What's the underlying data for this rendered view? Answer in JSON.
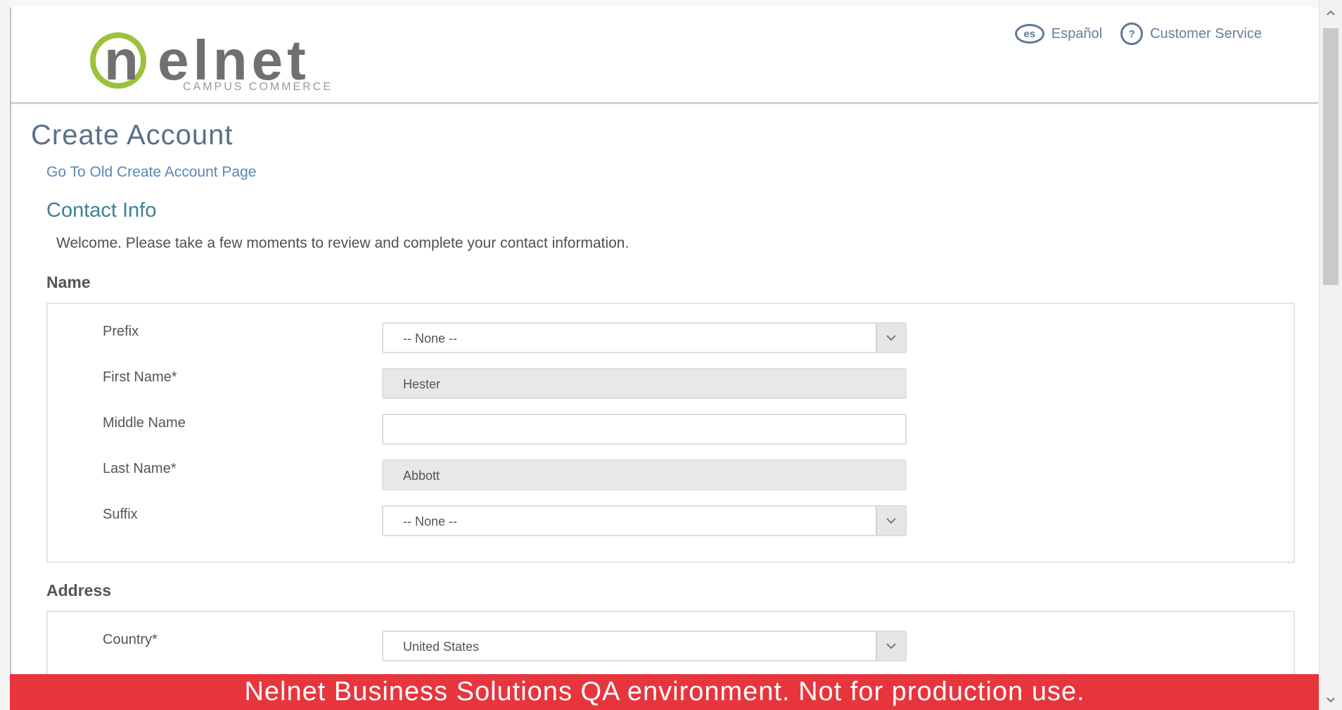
{
  "header": {
    "logo_text": "nelnet",
    "logo_subtitle": "CAMPUS COMMERCE",
    "lang_badge": "es",
    "lang_link": "Español",
    "help_badge": "?",
    "customer_service": "Customer Service"
  },
  "page": {
    "title": "Create Account",
    "old_page_link": "Go To Old Create Account Page",
    "section_title": "Contact Info",
    "welcome": "Welcome. Please take a few moments to review and complete your contact information."
  },
  "name_group": {
    "label": "Name",
    "fields": {
      "prefix": {
        "label": "Prefix",
        "value": "-- None --"
      },
      "first_name": {
        "label": "First Name*",
        "value": "Hester"
      },
      "middle_name": {
        "label": "Middle Name",
        "value": ""
      },
      "last_name": {
        "label": "Last Name*",
        "value": "Abbott"
      },
      "suffix": {
        "label": "Suffix",
        "value": "-- None --"
      }
    }
  },
  "address_group": {
    "label": "Address",
    "fields": {
      "country": {
        "label": "Country*",
        "value": "United States"
      }
    }
  },
  "banner": {
    "text": "Nelnet Business Solutions QA environment. Not for production use."
  },
  "colors": {
    "banner": "#e8353d",
    "link": "#5a87b5",
    "title": "#58708a",
    "logo_accent": "#9cc23c"
  },
  "icons": [
    "dropdown-caret-icon",
    "language-icon",
    "help-icon",
    "scroll-up-icon",
    "scroll-down-icon"
  ]
}
